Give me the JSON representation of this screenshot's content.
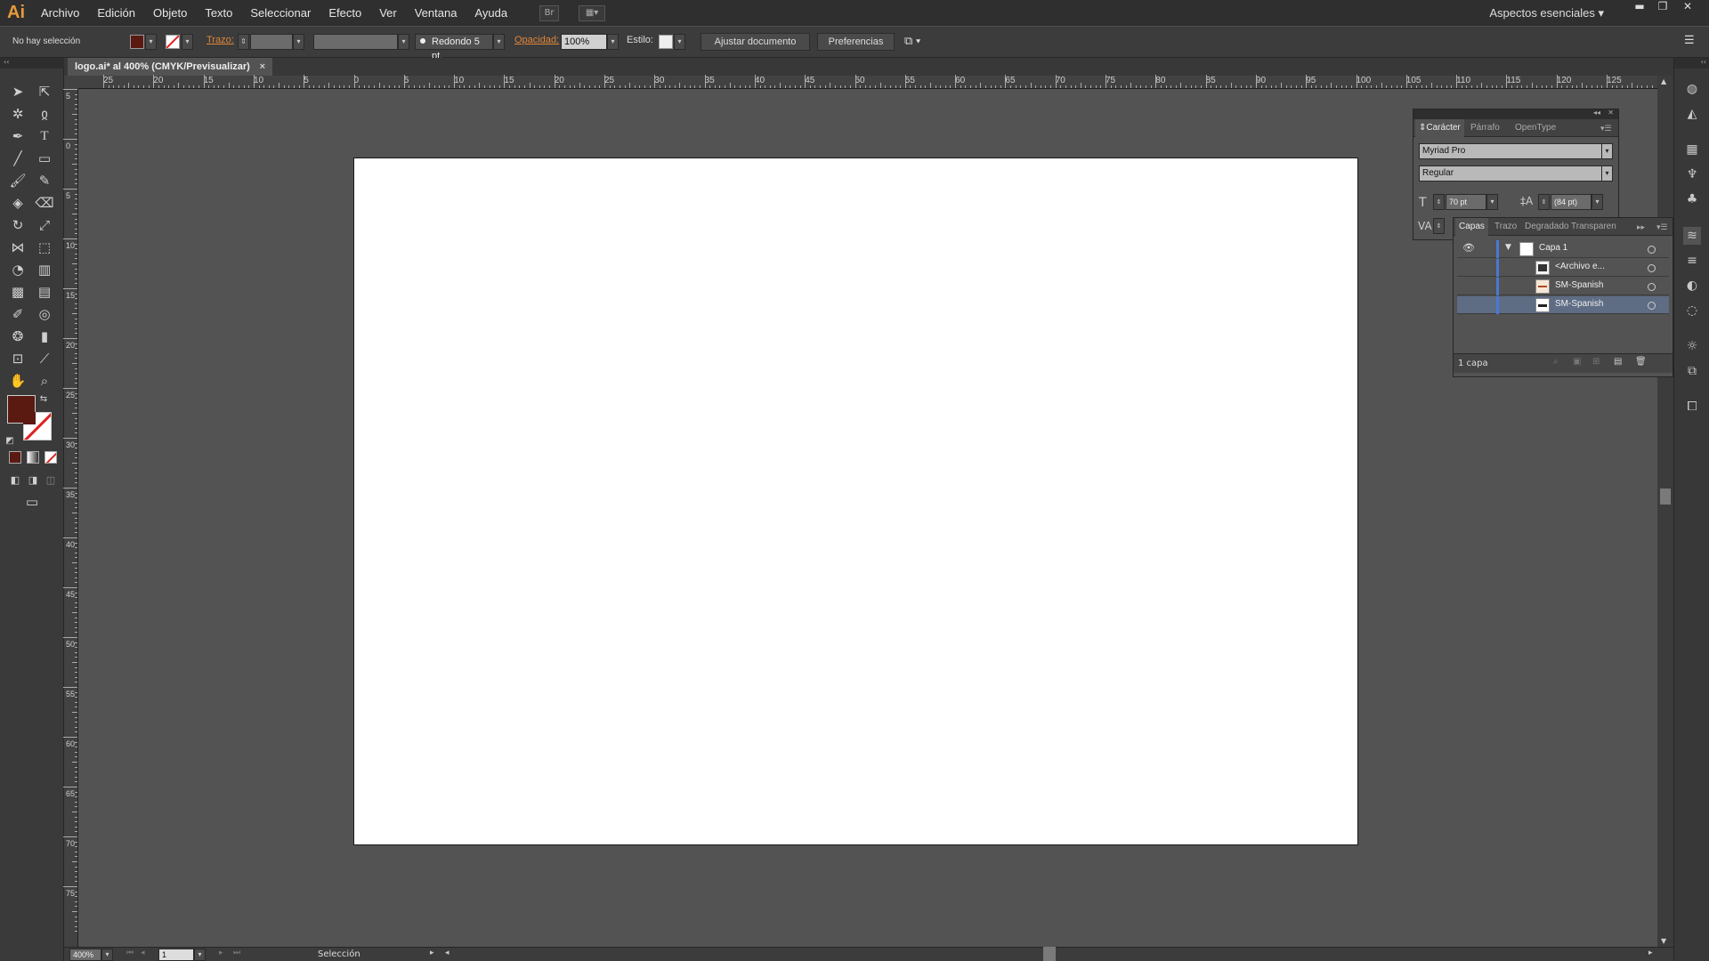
{
  "app": {
    "logo": "Ai",
    "menus": [
      "Archivo",
      "Edición",
      "Objeto",
      "Texto",
      "Seleccionar",
      "Efecto",
      "Ver",
      "Ventana",
      "Ayuda"
    ],
    "bridge_button": "Br",
    "workspace": "Aspectos esenciales"
  },
  "control_bar": {
    "selection_status": "No hay selección",
    "stroke_label": "Trazo:",
    "brush": "Redondo 5 pt.",
    "opacity_label": "Opacidad:",
    "opacity_value": "100%",
    "style_label": "Estilo:",
    "adjust_document": "Ajustar documento",
    "preferences": "Preferencias",
    "fill_color": "#5a1a12"
  },
  "document": {
    "tab_title": "logo.ai* al 400% (CMYK/Previsualizar)",
    "close_glyph": "×"
  },
  "ruler": {
    "h_labels": [
      "25",
      "20",
      "15",
      "10",
      "5",
      "0",
      "5",
      "10",
      "15",
      "20",
      "25",
      "30",
      "35",
      "40",
      "45",
      "50",
      "55",
      "60",
      "65",
      "70",
      "75",
      "80",
      "85",
      "90",
      "95",
      "100",
      "105",
      "110",
      "115",
      "120",
      "125"
    ],
    "v_labels": [
      "5",
      "0",
      "5",
      "10",
      "15",
      "20",
      "25",
      "30",
      "35",
      "40",
      "45",
      "50",
      "55",
      "60",
      "65",
      "70",
      "75"
    ]
  },
  "character_panel": {
    "tabs": [
      "Carácter",
      "Párrafo",
      "OpenType"
    ],
    "font_family": "Myriad Pro",
    "font_style": "Regular",
    "font_size": "70 pt",
    "leading": "(84 pt)"
  },
  "layers_panel": {
    "tabs": [
      "Capas",
      "Trazo",
      "Degradado",
      "Transparen"
    ],
    "rows": [
      {
        "name": "Capa 1"
      },
      {
        "name": "<Archivo e..."
      },
      {
        "name": "SM-Spanish"
      },
      {
        "name": "SM-Spanish"
      }
    ],
    "footer": "1 capa"
  },
  "status": {
    "zoom": "400%",
    "page": "1",
    "tool": "Selección"
  }
}
